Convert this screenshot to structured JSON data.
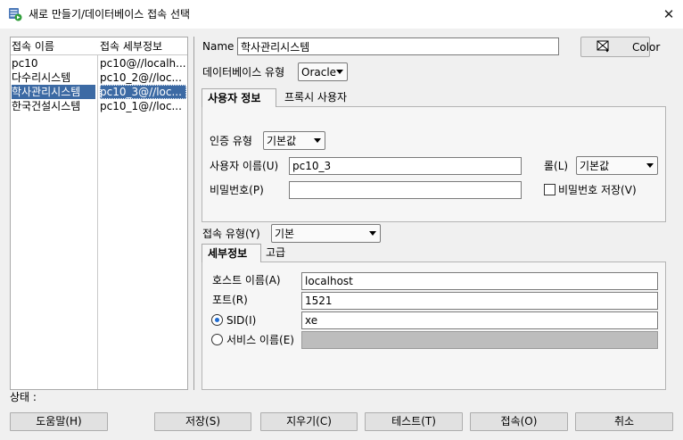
{
  "window": {
    "title": "새로 만들기/데이터베이스 접속 선택",
    "app_icon": "sql-developer-connection-icon",
    "close_icon": "close-icon"
  },
  "connections": {
    "headers": [
      "접속 이름",
      "접속 세부정보"
    ],
    "rows": [
      {
        "name": "pc10",
        "details": "pc10@//localh...",
        "selected": false
      },
      {
        "name": "다수리시스템",
        "details": "pc10_2@//loc...",
        "selected": false
      },
      {
        "name": "학사관리시스템",
        "details": "pc10_3@//loc...",
        "selected": true
      },
      {
        "name": "한국건설시스템",
        "details": "pc10_1@//loc...",
        "selected": false
      }
    ]
  },
  "form": {
    "name_label": "Name",
    "name_value": "학사관리시스템",
    "color_label": "Color",
    "color_icon": "color-picker-icon",
    "db_type_label": "데이터베이스 유형",
    "db_type_value": "Oracle"
  },
  "user_tabs": {
    "tabs": [
      "사용자 정보",
      "프록시 사용자"
    ],
    "active": 0
  },
  "user_info": {
    "auth_type_label": "인증 유형",
    "auth_type_value": "기본값",
    "username_label": "사용자 이름(U)",
    "username_value": "pc10_3",
    "role_label": "롤(L)",
    "role_value": "기본값",
    "password_label": "비밀번호(P)",
    "password_value": "",
    "save_password_label": "비밀번호 저장(V)",
    "save_password_checked": false
  },
  "connection_type": {
    "label": "접속 유형(Y)",
    "value": "기본"
  },
  "detail_tabs": {
    "tabs": [
      "세부정보",
      "고급"
    ],
    "active": 0
  },
  "details": {
    "host_label": "호스트 이름(A)",
    "host_value": "localhost",
    "port_label": "포트(R)",
    "port_value": "1521",
    "sid_label": "SID(I)",
    "sid_value": "xe",
    "sid_selected": true,
    "service_label": "서비스 이름(E)",
    "service_value": "",
    "service_selected": false
  },
  "status": {
    "label": "상태 :"
  },
  "buttons": {
    "help": "도움말(H)",
    "save": "저장(S)",
    "clear": "지우기(C)",
    "test": "테스트(T)",
    "connect": "접속(O)",
    "cancel": "취소"
  }
}
